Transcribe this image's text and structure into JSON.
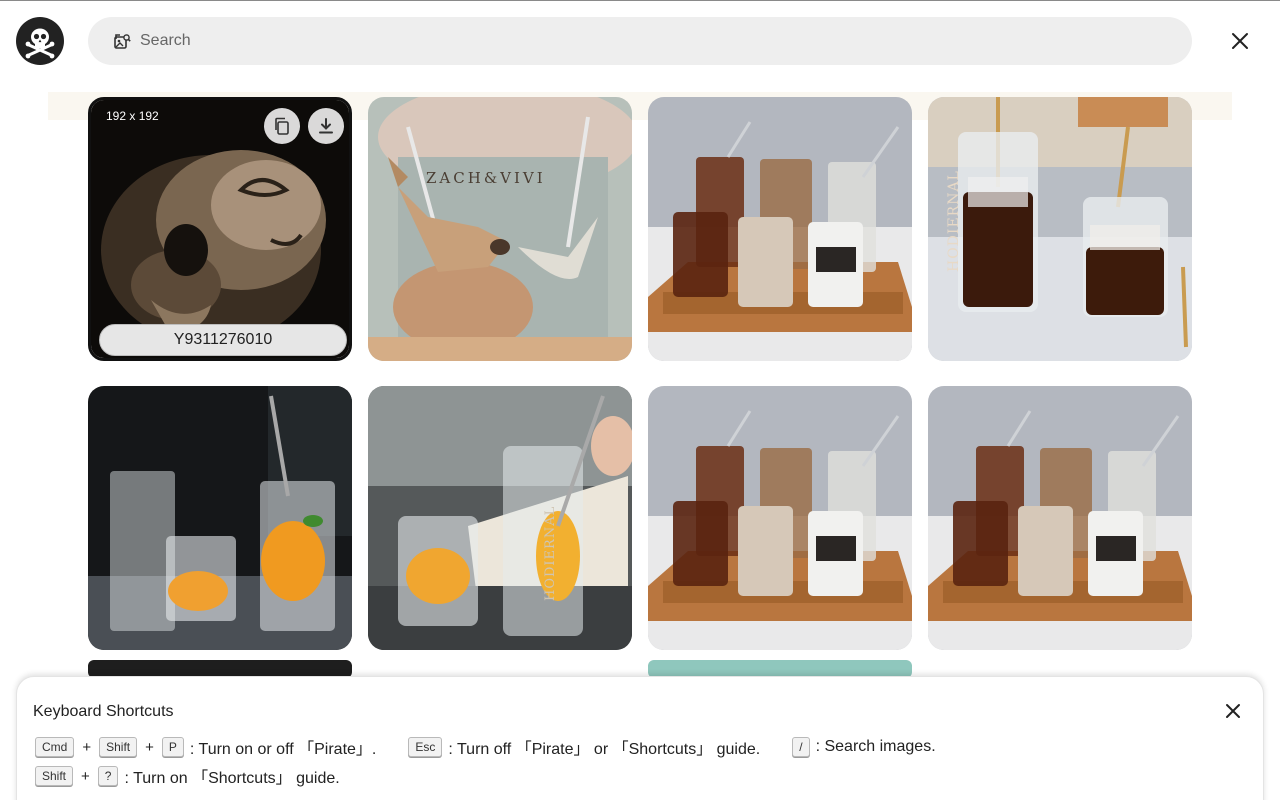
{
  "search": {
    "placeholder": "Search"
  },
  "grid": {
    "tiles": [
      {
        "dims": "192 x 192",
        "code": "Y9311276010"
      },
      {
        "brand_text": "ZACH&VIVI"
      },
      {},
      {
        "brand_text": "HODIERNAL"
      },
      {},
      {
        "brand_text": "HODIERNAL"
      },
      {},
      {}
    ]
  },
  "shortcuts": {
    "title": "Keyboard Shortcuts",
    "row1": {
      "k1": "Cmd",
      "plus1": "+",
      "k2": "Shift",
      "plus2": "+",
      "k3": "P",
      "t1": ": Turn on or off 「Pirate」.",
      "k4": "Esc",
      "t2": ": Turn off 「Pirate」 or 「Shortcuts」 guide.",
      "k5": "/",
      "t3": ": Search images."
    },
    "row2": {
      "k1": "Shift",
      "plus1": "+",
      "k2": "?",
      "t1": ": Turn on 「Shortcuts」 guide."
    }
  },
  "colors": {
    "overlay": "#ffffff",
    "search_bg": "#eeeeee",
    "accent_dark": "#222222"
  }
}
